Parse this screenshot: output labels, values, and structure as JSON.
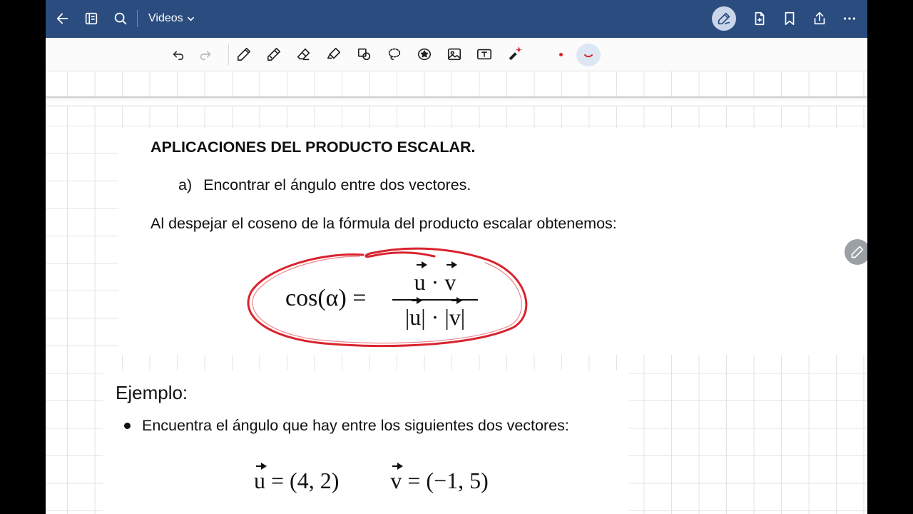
{
  "navbar": {
    "title": "Videos",
    "icons": [
      "back-arrow-icon",
      "notebook-list-icon",
      "search-icon",
      "chevron-down-icon",
      "pen-mode-icon",
      "add-page-icon",
      "bookmark-icon",
      "share-icon",
      "more-icon"
    ]
  },
  "toolbar": {
    "icons": [
      "undo-icon",
      "redo-icon",
      "pen-icon",
      "pencil-icon",
      "eraser-icon",
      "highlighter-icon",
      "shapes-icon",
      "lasso-icon",
      "sticker-icon",
      "image-icon",
      "text-box-icon",
      "laser-pointer-icon"
    ],
    "pen_colors": [
      "#d9232d",
      "#d9232d"
    ]
  },
  "document": {
    "heading": "APLICACIONES DEL PRODUCTO ESCALAR.",
    "item_a_marker": "a)",
    "item_a_text": "Encontrar el ángulo entre dos vectores.",
    "intro": "Al despejar el coseno de la fórmula del producto escalar obtenemos:",
    "formula": {
      "lhs": "cos(α) =",
      "num_u": "u",
      "num_dot": " · ",
      "num_v": "v",
      "den_bar1": "|",
      "den_u": "u",
      "den_mid": "| · |",
      "den_v": "v",
      "den_bar2": "|"
    },
    "example_title": "Ejemplo:",
    "example_bullet": "Encuentra el ángulo que hay entre los siguientes dos vectores:",
    "vector_u_name": "u",
    "vector_u_value": " = (4, 2)",
    "vector_v_name": "v",
    "vector_v_value": " = (−1, 5)"
  },
  "annotation": {
    "ink_color": "#d9232d"
  }
}
